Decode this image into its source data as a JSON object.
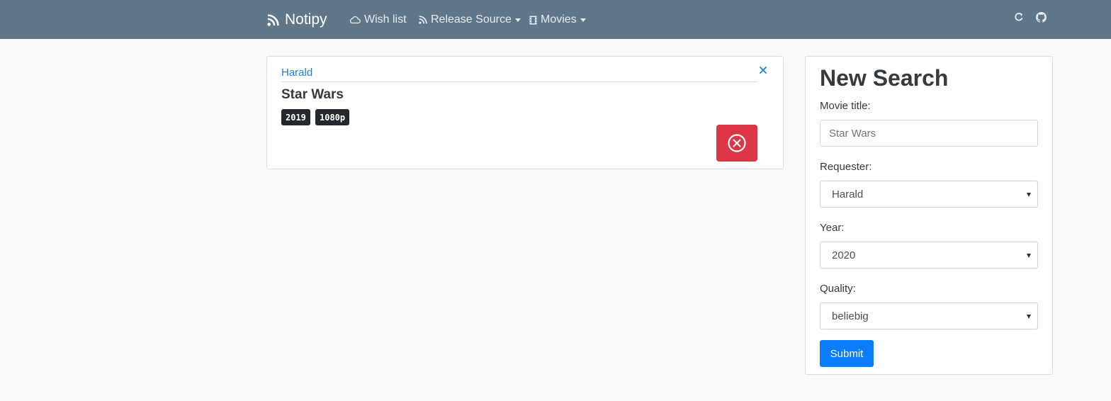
{
  "navbar": {
    "brand": "Notipy",
    "items": [
      {
        "label": "Wish list",
        "icon": "cloud-icon"
      },
      {
        "label": "Release Source",
        "icon": "rss-icon"
      },
      {
        "label": "Movies",
        "icon": "film-icon"
      }
    ],
    "right_icons": [
      "refresh-icon",
      "github-icon"
    ]
  },
  "card": {
    "requester": "Harald",
    "title": "Star Wars",
    "badges": [
      "2019",
      "1080p"
    ],
    "delete_icon": "times-circle-icon",
    "close_icon": "close-icon"
  },
  "search": {
    "title": "New Search",
    "movie_title_label": "Movie title:",
    "movie_title_placeholder": "Star Wars",
    "requester_label": "Requester:",
    "requester_value": "Harald",
    "year_label": "Year:",
    "year_value": "2020",
    "quality_label": "Quality:",
    "quality_value": "beliebig",
    "submit_label": "Submit"
  },
  "colors": {
    "navbar": "#60778a",
    "link": "#1a7fe3",
    "danger": "#dc3545",
    "primary": "#0b7dfb",
    "badge": "#22282e"
  }
}
